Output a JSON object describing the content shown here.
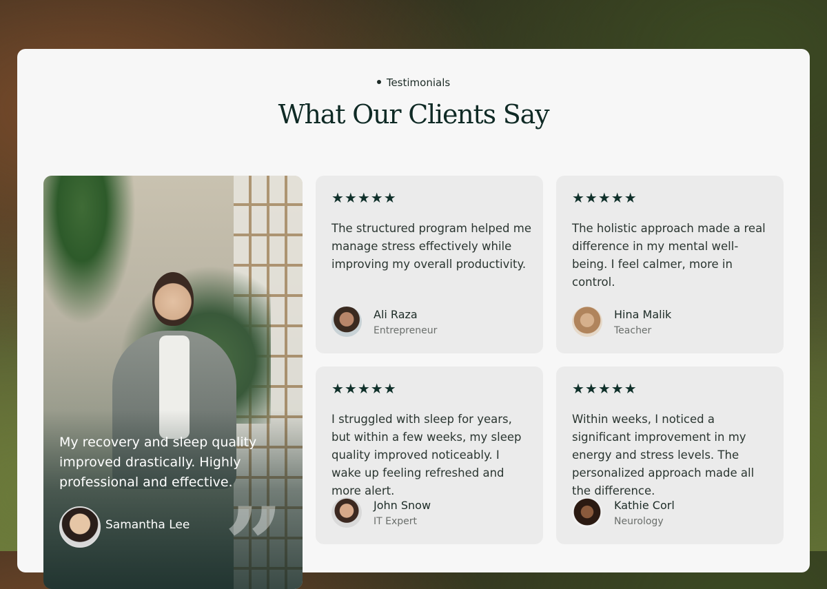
{
  "section": {
    "eyebrow": "Testimonials",
    "title": "What Our Clients Say"
  },
  "featured": {
    "quote": "My recovery and sleep quality improved drastically. Highly professional and effective.",
    "name": "Samantha Lee",
    "quote_mark": "”"
  },
  "cards": [
    {
      "stars": "★★★★★",
      "rating": 5,
      "quote": "The structured program helped me manage stress effectively while improving my overall productivity.",
      "name": "Ali Raza",
      "role": "Entrepreneur"
    },
    {
      "stars": "★★★★★",
      "rating": 5,
      "quote": "The holistic approach made a real difference in my mental well-being. I feel calmer, more in control.",
      "name": "Hina Malik",
      "role": "Teacher"
    },
    {
      "stars": "★★★★★",
      "rating": 5,
      "quote": "I struggled with sleep for years, but within a few weeks, my sleep quality improved noticeably. I wake up feeling refreshed and more alert.",
      "name": "John Snow",
      "role": "IT Expert"
    },
    {
      "stars": "★★★★★",
      "rating": 5,
      "quote": "Within weeks, I noticed a significant improvement in my energy and stress levels. The personalized approach made all the difference.",
      "name": "Kathie Corl",
      "role": "Neurology"
    }
  ],
  "colors": {
    "panel": "#f7f7f7",
    "card": "#ebebeb",
    "heading": "#0f2a25",
    "star": "#10302a"
  },
  "icons": {
    "rating": "star-icon",
    "quote": "quote-icon"
  }
}
